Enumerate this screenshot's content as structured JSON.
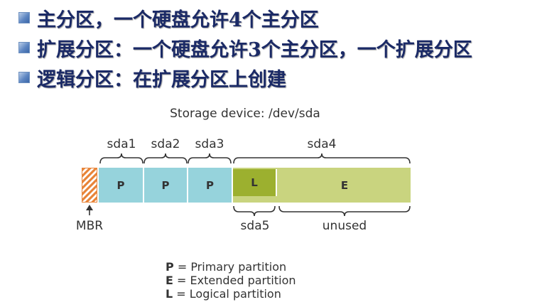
{
  "bullets": [
    "主分区，一个硬盘允许4个主分区",
    "扩展分区：一个硬盘允许3个主分区，一个扩展分区",
    "逻辑分区：在扩展分区上创建"
  ],
  "diagram": {
    "title": "Storage device: /dev/sda",
    "labels": {
      "sda1": "sda1",
      "sda2": "sda2",
      "sda3": "sda3",
      "sda4": "sda4",
      "sda5": "sda5",
      "unused": "unused",
      "mbr": "MBR"
    },
    "partitions": {
      "p1": "P",
      "p2": "P",
      "p3": "P",
      "logical": "L",
      "extended": "E"
    },
    "legend": [
      {
        "key": "P",
        "text": " = Primary partition"
      },
      {
        "key": "E",
        "text": " = Extended partition"
      },
      {
        "key": "L",
        "text": " = Logical partition"
      }
    ],
    "colors": {
      "primary": "#96d3dc",
      "extended": "#c9d47f",
      "logical": "#9cb02f",
      "mbr": "#e8853a",
      "heading": "#1b2a66"
    }
  }
}
